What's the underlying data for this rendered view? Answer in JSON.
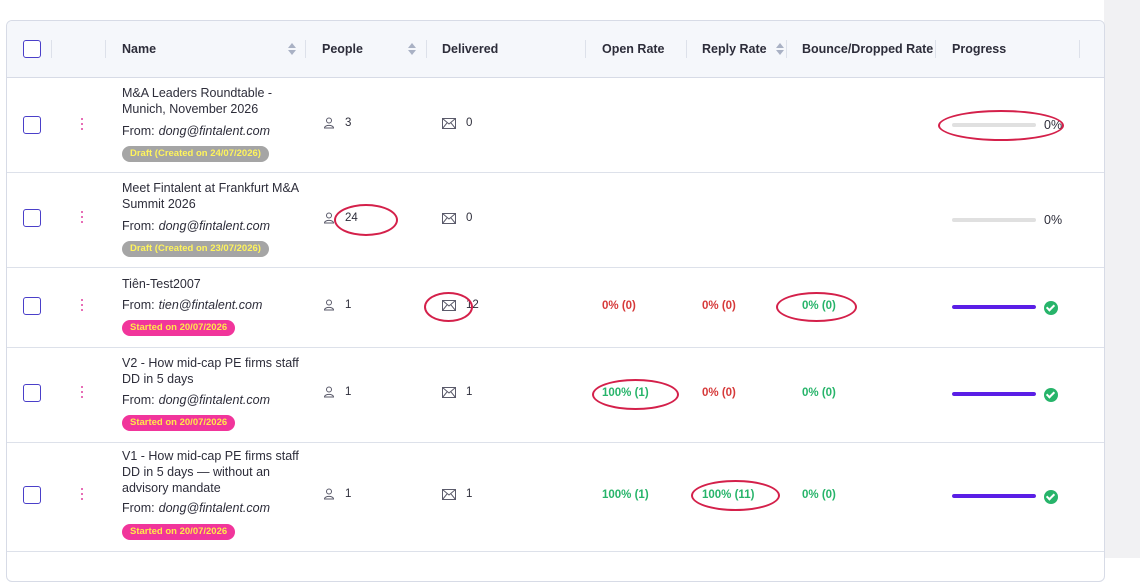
{
  "header": {
    "name": "Name",
    "people": "People",
    "delivered": "Delivered",
    "open_rate": "Open Rate",
    "reply_rate": "Reply Rate",
    "bounce_rate": "Bounce/Dropped Rate",
    "progress": "Progress"
  },
  "from_label": "From:",
  "rows": [
    {
      "name": "M&A Leaders Roundtable - Munich, November 2026",
      "email": "dong@fintalent.com",
      "badge": "Draft (Created on 24/07/2026)",
      "badge_type": "draft",
      "people": "3",
      "delivered": "0",
      "open_rate": "",
      "reply_rate": "",
      "bounce_rate": "",
      "progress": 0,
      "progress_label": "0%"
    },
    {
      "name": "Meet Fintalent at Frankfurt M&A Summit 2026",
      "email": "dong@fintalent.com",
      "badge": "Draft (Created on 23/07/2026)",
      "badge_type": "draft",
      "people": "24",
      "delivered": "0",
      "open_rate": "",
      "reply_rate": "",
      "bounce_rate": "",
      "progress": 0,
      "progress_label": "0%"
    },
    {
      "name": "Tiên-Test2007",
      "email": "tien@fintalent.com",
      "badge": "Started on 20/07/2026",
      "badge_type": "started",
      "people": "1",
      "delivered": "12",
      "open_rate": "0% (0)",
      "reply_rate": "0% (0)",
      "bounce_rate": "0% (0)",
      "progress": 1,
      "progress_label": ""
    },
    {
      "name": "V2 - How mid-cap PE firms staff DD in 5 days",
      "email": "dong@fintalent.com",
      "badge": "Started on 20/07/2026",
      "badge_type": "started",
      "people": "1",
      "delivered": "1",
      "open_rate": "100% (1)",
      "reply_rate": "0% (0)",
      "bounce_rate": "0% (0)",
      "progress": 1,
      "progress_label": ""
    },
    {
      "name": "V1 - How mid-cap PE firms staff DD in 5 days — without an advisory mandate",
      "email": "dong@fintalent.com",
      "badge": "Started on 20/07/2026",
      "badge_type": "started",
      "people": "1",
      "delivered": "1",
      "open_rate": "100% (1)",
      "reply_rate": "100% (11)",
      "bounce_rate": "0% (0)",
      "progress": 1,
      "progress_label": ""
    }
  ],
  "colors": {
    "accent": "#4a3fc9",
    "progress_fill": "#5a1ee6",
    "rate_red": "#d63a3a",
    "rate_green": "#27b46a",
    "annotation": "#d4204a",
    "draft_badge": "#a5a5a5",
    "started_badge": "#f1359b"
  }
}
